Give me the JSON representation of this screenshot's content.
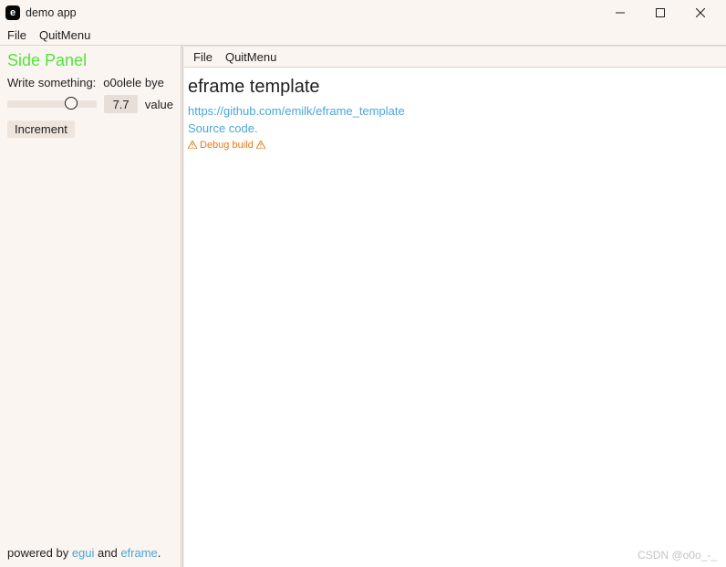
{
  "titlebar": {
    "icon_letter": "e",
    "title": "demo app"
  },
  "outer_menu": {
    "file": "File",
    "quit": "QuitMenu"
  },
  "side": {
    "heading": "Side Panel",
    "write_label": "Write something:",
    "write_value": "o0olele bye",
    "slider_value_text": "7.7",
    "slider_fraction": 0.72,
    "value_label": "value",
    "increment_label": "Increment",
    "footer_prefix": "powered by ",
    "footer_link1": "egui",
    "footer_and": " and ",
    "footer_link2": "eframe",
    "footer_suffix": "."
  },
  "inner_menu": {
    "file": "File",
    "quit": "QuitMenu"
  },
  "main": {
    "heading": "eframe template",
    "repo_link": "https://github.com/emilk/eframe_template",
    "source_link": "Source code.",
    "debug_text": "Debug build"
  },
  "watermark": "CSDN @o0o_-_"
}
